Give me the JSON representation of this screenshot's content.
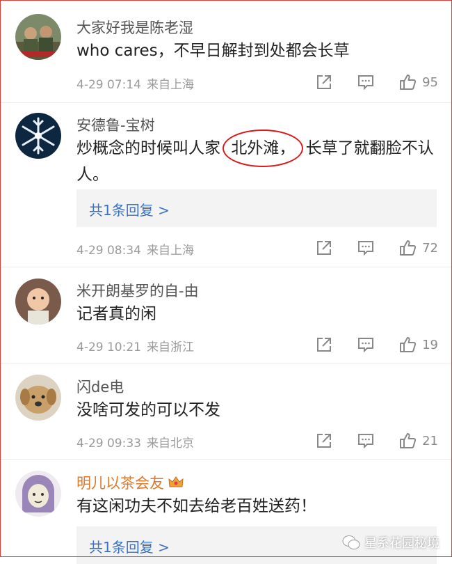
{
  "comments": [
    {
      "username": "大家好我是陈老湿",
      "text": "who cares，不早日解封到处都会长草",
      "date": "4-29 07:14",
      "location": "来自上海",
      "likes": "95"
    },
    {
      "username": "安德鲁-宝树",
      "text_before": "炒概念的时候叫人家 ",
      "text_circled": "北外滩，",
      "text_after": " 长草了就翻脸不认人。",
      "reply_label": "共1条回复 >",
      "date": "4-29 08:34",
      "location": "来自上海",
      "likes": "72"
    },
    {
      "username": "米开朗基罗的自-由",
      "text": "记者真的闲",
      "date": "4-29 10:21",
      "location": "来自浙江",
      "likes": "19"
    },
    {
      "username": "闪de电",
      "text": "没啥可发的可以不发",
      "date": "4-29 09:33",
      "location": "来自北京",
      "likes": "21"
    },
    {
      "username": "明儿以茶会友",
      "text": "有这闲功夫不如去给老百姓送药！",
      "reply_label": "共1条回复 >"
    }
  ],
  "watermark": "星系花园秘境",
  "colors": {
    "username": "#555555",
    "vip_username": "#e0792a",
    "reply_link": "#3b71c2",
    "annotation_circle": "#d91a1a",
    "frame": "#e23b3b"
  }
}
